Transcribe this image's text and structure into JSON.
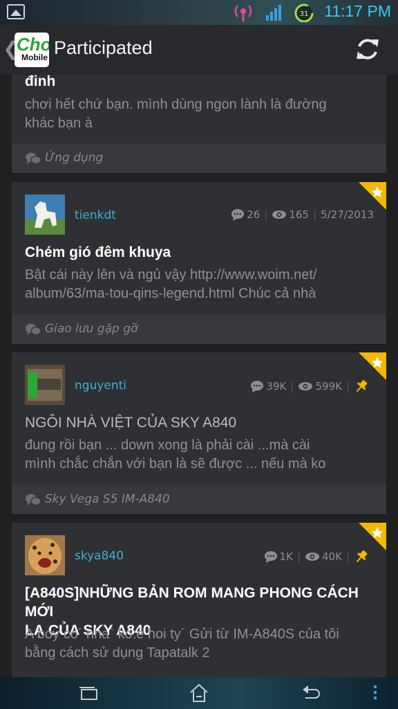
{
  "status_bar": {
    "time": "11:17 PM",
    "calendar_day": "31"
  },
  "action_bar": {
    "logo_line1": "Choi",
    "logo_line2": "Mobile",
    "title": "Participated"
  },
  "topics": [
    {
      "title": "đinh",
      "excerpt": [
        "chơi hết chứ bạn. mình dùng ngon lành là đường",
        "khác bạn à"
      ],
      "forum": "Ứng dụng"
    },
    {
      "username": "tienkdt",
      "replies": "26",
      "views": "165",
      "date": "5/27/2013",
      "title": "Chém gió đêm khuya",
      "excerpt": [
        "Bật cái này lên và ngủ vậy http://www.woim.net/",
        "album/63/ma-tou-qins-legend.html Chúc cả nhà"
      ],
      "forum": "Giao lưu gặp gỡ"
    },
    {
      "username": "nguyenti",
      "replies": "39K",
      "views": "599K",
      "title": "NGÔI NHÀ VIỆT CỦA SKY A840",
      "excerpt": [
        "đung rồi bạn ... down xong là phải cài ...mà cài",
        "mình chắc chắn với bạn là sẽ được ... nếu mà ko"
      ],
      "forum": "Sky Vega S5 IM-A840"
    },
    {
      "username": "skya840",
      "replies": "1K",
      "views": "40K",
      "title": [
        "[A840S]NHỮNG BẢN ROM MANG PHONG CÁCH MỚI",
        "LẠ CỦA SKY A840"
      ],
      "excerpt": [
        "A boy co´ nha` ko.e hoi ty´ Gửi từ IM-A840S của tôi",
        "bằng cách sử dụng Tapatalk 2"
      ]
    }
  ],
  "colors": {
    "accent": "#3eb0d6",
    "badge": "#f5b800"
  }
}
